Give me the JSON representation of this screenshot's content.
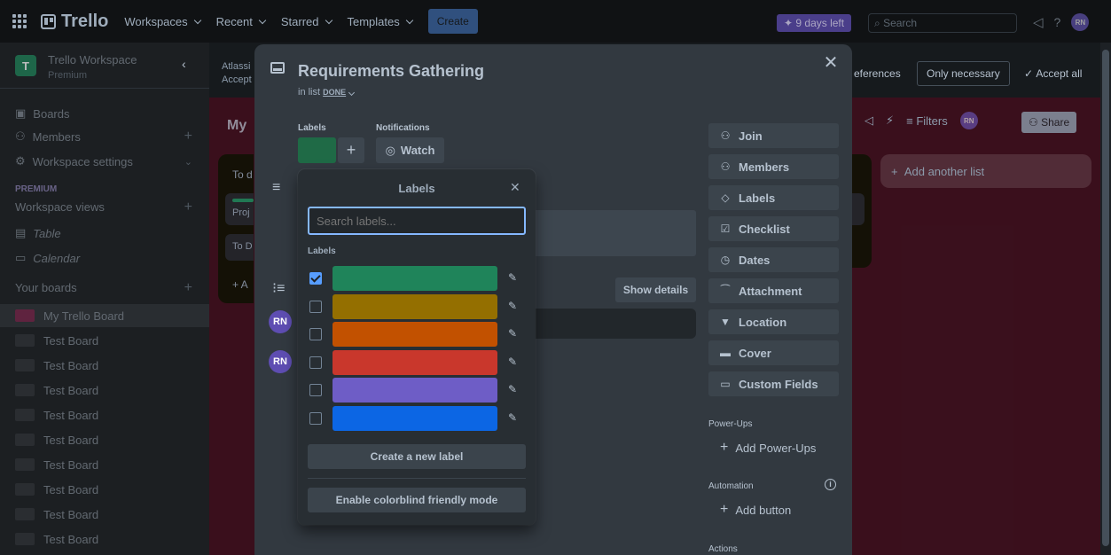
{
  "topnav": {
    "logo": "Trello",
    "items": [
      "Workspaces",
      "Recent",
      "Starred",
      "Templates"
    ],
    "create": "Create",
    "trial": "9 days left",
    "search_placeholder": "Search",
    "avatar": "RN"
  },
  "sidebar": {
    "workspace_initial": "T",
    "workspace_name": "Trello Workspace",
    "workspace_plan": "Premium",
    "nav": [
      "Boards",
      "Members",
      "Workspace settings"
    ],
    "premium_label": "PREMIUM",
    "views_label": "Workspace views",
    "views": [
      "Table",
      "Calendar"
    ],
    "your_boards": "Your boards",
    "boards": [
      "My Trello Board",
      "Test Board",
      "Test Board",
      "Test Board",
      "Test Board",
      "Test Board",
      "Test Board",
      "Test Board",
      "Test Board",
      "Test Board"
    ]
  },
  "background": {
    "cookie_left_1": "Atlassi",
    "cookie_left_2": "Accept",
    "cookie_prefs": "eferences",
    "cookie_only_necessary": "Only necessary",
    "cookie_accept_all": "Accept all",
    "board_title": "My",
    "list_title": "To d",
    "card1": "Proj",
    "card2": "To D",
    "add_card": "+ A",
    "filters": "Filters",
    "share": "Share",
    "board_avatar": "RN",
    "add_list": "Add another list"
  },
  "card": {
    "title": "Requirements Gathering",
    "in_list_prefix": "in list",
    "list_name": "DONE",
    "labels_heading": "Labels",
    "notifications_heading": "Notifications",
    "watch": "Watch",
    "show_details": "Show details",
    "member_initials": "RN"
  },
  "actions": {
    "buttons": [
      {
        "icon": "person-add-icon",
        "glyph": "⚇",
        "label": "Join"
      },
      {
        "icon": "members-icon",
        "glyph": "⚇",
        "label": "Members"
      },
      {
        "icon": "label-icon",
        "glyph": "◇",
        "label": "Labels"
      },
      {
        "icon": "checklist-icon",
        "glyph": "☑",
        "label": "Checklist"
      },
      {
        "icon": "clock-icon",
        "glyph": "◷",
        "label": "Dates"
      },
      {
        "icon": "paperclip-icon",
        "glyph": "⁀",
        "label": "Attachment"
      },
      {
        "icon": "location-icon",
        "glyph": "▼",
        "label": "Location"
      },
      {
        "icon": "cover-icon",
        "glyph": "▬",
        "label": "Cover"
      },
      {
        "icon": "custom-fields-icon",
        "glyph": "▭",
        "label": "Custom Fields"
      }
    ],
    "powerups_heading": "Power-Ups",
    "add_powerups": "Add Power-Ups",
    "automation_heading": "Automation",
    "add_button": "Add button",
    "actions_heading": "Actions"
  },
  "labels_popover": {
    "title": "Labels",
    "search_placeholder": "Search labels...",
    "section": "Labels",
    "labels": [
      {
        "color": "#1f845a",
        "checked": true
      },
      {
        "color": "#946f00",
        "checked": false
      },
      {
        "color": "#c25100",
        "checked": false
      },
      {
        "color": "#c9372c",
        "checked": false
      },
      {
        "color": "#6e5dc6",
        "checked": false
      },
      {
        "color": "#0c66e4",
        "checked": false
      }
    ],
    "create": "Create a new label",
    "colorblind": "Enable colorblind friendly mode"
  }
}
